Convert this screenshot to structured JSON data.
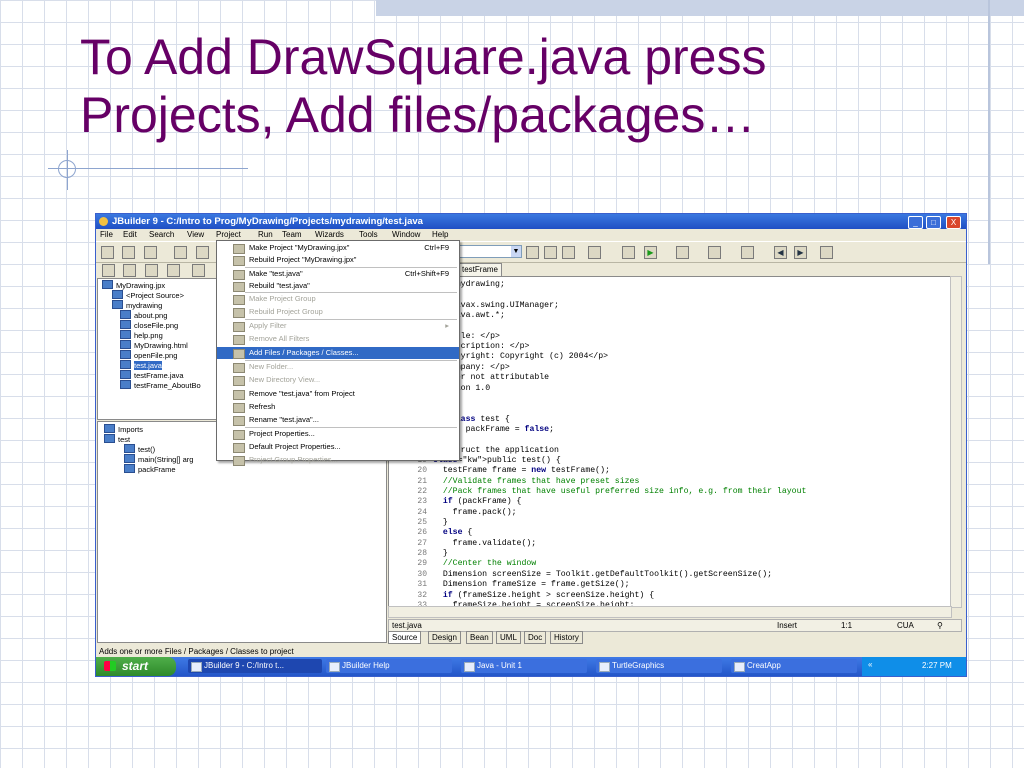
{
  "slide": {
    "title_line1": "To Add DrawSquare.java press",
    "title_line2": "Projects, Add files/packages…"
  },
  "window": {
    "title": "JBuilder 9 - C:/Intro to Prog/MyDrawing/Projects/mydrawing/test.java",
    "min": "_",
    "max": "□",
    "close": "X"
  },
  "menubar": [
    "File",
    "Edit",
    "Search",
    "View",
    "Project",
    "Run",
    "Team",
    "Wizards",
    "Tools",
    "Window",
    "Help"
  ],
  "project_menu": [
    {
      "label": "Make Project \"MyDrawing.jpx\"",
      "shortcut": "Ctrl+F9",
      "enabled": true
    },
    {
      "label": "Rebuild Project \"MyDrawing.jpx\"",
      "shortcut": "",
      "enabled": true
    },
    {
      "label": "Make \"test.java\"",
      "shortcut": "Ctrl+Shift+F9",
      "enabled": true
    },
    {
      "label": "Rebuild \"test.java\"",
      "shortcut": "",
      "enabled": true
    },
    {
      "label": "Make Project Group",
      "shortcut": "",
      "enabled": false
    },
    {
      "label": "Rebuild Project Group",
      "shortcut": "",
      "enabled": false
    },
    {
      "label": "Apply Filter",
      "shortcut": "▸",
      "enabled": false
    },
    {
      "label": "Remove All Filters",
      "shortcut": "",
      "enabled": false
    },
    {
      "label": "Add Files / Packages / Classes...",
      "shortcut": "",
      "enabled": true,
      "highlighted": true
    },
    {
      "label": "New Folder...",
      "shortcut": "",
      "enabled": false
    },
    {
      "label": "New Directory View...",
      "shortcut": "",
      "enabled": false
    },
    {
      "label": "Remove \"test.java\" from Project",
      "shortcut": "",
      "enabled": true
    },
    {
      "label": "Refresh",
      "shortcut": "",
      "enabled": true
    },
    {
      "label": "Rename \"test.java\"...",
      "shortcut": "",
      "enabled": true
    },
    {
      "label": "Project Properties...",
      "shortcut": "",
      "enabled": true
    },
    {
      "label": "Default Project Properties...",
      "shortcut": "",
      "enabled": true
    },
    {
      "label": "Project Group Properties...",
      "shortcut": "",
      "enabled": false
    }
  ],
  "project_tree": [
    {
      "label": "MyDrawing.jpx",
      "depth": 0,
      "selected": false
    },
    {
      "label": "<Project Source>",
      "depth": 1,
      "selected": false
    },
    {
      "label": "mydrawing",
      "depth": 1,
      "selected": false
    },
    {
      "label": "about.png",
      "depth": 2,
      "selected": false
    },
    {
      "label": "closeFile.png",
      "depth": 2,
      "selected": false
    },
    {
      "label": "help.png",
      "depth": 2,
      "selected": false
    },
    {
      "label": "MyDrawing.html",
      "depth": 2,
      "selected": false
    },
    {
      "label": "openFile.png",
      "depth": 2,
      "selected": false
    },
    {
      "label": "test.java",
      "depth": 2,
      "selected": true
    },
    {
      "label": "testFrame.java",
      "depth": 2,
      "selected": false
    },
    {
      "label": "testFrame_AboutBo",
      "depth": 2,
      "selected": false
    }
  ],
  "structure_tree": [
    {
      "label": "Imports",
      "depth": 0
    },
    {
      "label": "test",
      "depth": 0
    },
    {
      "label": "test()",
      "depth": 1
    },
    {
      "label": "main(String[] arg",
      "depth": 1
    },
    {
      "label": "packFrame",
      "depth": 1
    }
  ],
  "editor": {
    "tab_label": "testFrame",
    "lines": [
      {
        "n": "",
        "t": "ge mydrawing;"
      },
      {
        "n": "",
        "t": ""
      },
      {
        "n": "",
        "t": "t javax.swing.UIManager;"
      },
      {
        "n": "",
        "t": "t java.awt.*;"
      },
      {
        "n": "",
        "t": ""
      },
      {
        "n": "",
        "t": ">Title: </p>"
      },
      {
        "n": "",
        "t": ">Description: </p>"
      },
      {
        "n": "",
        "t": ">Copyright: Copyright (c) 2004</p>"
      },
      {
        "n": "",
        "t": ">Company: </p>"
      },
      {
        "n": "",
        "t": "uthor not attributable"
      },
      {
        "n": "",
        "t": "ersion 1.0"
      },
      {
        "n": "",
        "t": ""
      },
      {
        "n": "",
        "t": ""
      },
      {
        "n": "",
        "t": "c class test {"
      },
      {
        "n": "",
        "t": "lean packFrame = false;"
      },
      {
        "n": "",
        "t": ""
      },
      {
        "n": "",
        "t": "onstruct the application"
      },
      {
        "n": "19",
        "t": "public test() {"
      },
      {
        "n": "20",
        "t": "  testFrame frame = new testFrame();"
      },
      {
        "n": "21",
        "t": "  //Validate frames that have preset sizes"
      },
      {
        "n": "22",
        "t": "  //Pack frames that have useful preferred size info, e.g. from their layout"
      },
      {
        "n": "23",
        "t": "  if (packFrame) {"
      },
      {
        "n": "24",
        "t": "    frame.pack();"
      },
      {
        "n": "25",
        "t": "  }"
      },
      {
        "n": "26",
        "t": "  else {"
      },
      {
        "n": "27",
        "t": "    frame.validate();"
      },
      {
        "n": "28",
        "t": "  }"
      },
      {
        "n": "29",
        "t": "  //Center the window"
      },
      {
        "n": "30",
        "t": "  Dimension screenSize = Toolkit.getDefaultToolkit().getScreenSize();"
      },
      {
        "n": "31",
        "t": "  Dimension frameSize = frame.getSize();"
      },
      {
        "n": "32",
        "t": "  if (frameSize.height > screenSize.height) {"
      },
      {
        "n": "33",
        "t": "    frameSize.height = screenSize.height;"
      }
    ]
  },
  "editor_status": {
    "file": "test.java",
    "mode": "Insert",
    "pos": "1:1",
    "keymap": "CUA"
  },
  "bottom_tabs": [
    "Source",
    "Design",
    "Bean",
    "UML",
    "Doc",
    "History"
  ],
  "statusbar": "Adds one or more Files / Packages / Classes to project",
  "taskbar": {
    "start": "start",
    "tasks": [
      "JBuilder 9 - C:/Intro t...",
      "JBuilder Help",
      "Java - Unit 1",
      "TurtleGraphics",
      "CreatApp"
    ],
    "clock": "2:27 PM"
  }
}
